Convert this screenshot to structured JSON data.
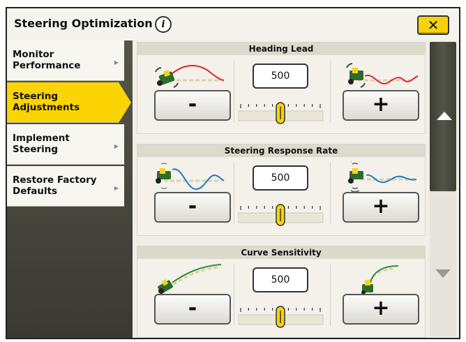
{
  "dialog": {
    "title": "Steering Optimization",
    "info_icon": "info-icon",
    "close_label": "✕"
  },
  "sidebar": {
    "items": [
      {
        "line1": "Monitor",
        "line2": "Performance",
        "active": false
      },
      {
        "line1": "Steering",
        "line2": "Adjustments",
        "active": true
      },
      {
        "line1": "Implement",
        "line2": "Steering",
        "active": false
      },
      {
        "line1": "Restore Factory",
        "line2": "Defaults",
        "active": false
      }
    ],
    "arrow": "▶"
  },
  "sections": [
    {
      "title": "Heading Lead",
      "value": "500",
      "minus_label": "-",
      "plus_label": "+",
      "slider_fraction": 0.5
    },
    {
      "title": "Steering Response Rate",
      "value": "500",
      "minus_label": "-",
      "plus_label": "+",
      "slider_fraction": 0.5
    },
    {
      "title": "Curve Sensitivity",
      "value": "500",
      "minus_label": "-",
      "plus_label": "+",
      "slider_fraction": 0.5
    }
  ],
  "scrollbar": {
    "up_icon": "triangle-up-icon",
    "down_icon": "triangle-down-icon"
  },
  "colors": {
    "accent_yellow": "#fcd404",
    "tractor_green": "#2f6b2a",
    "curve_red": "#e0232b",
    "curve_blue": "#1f7ac4",
    "curve_green": "#2f8a3a"
  }
}
